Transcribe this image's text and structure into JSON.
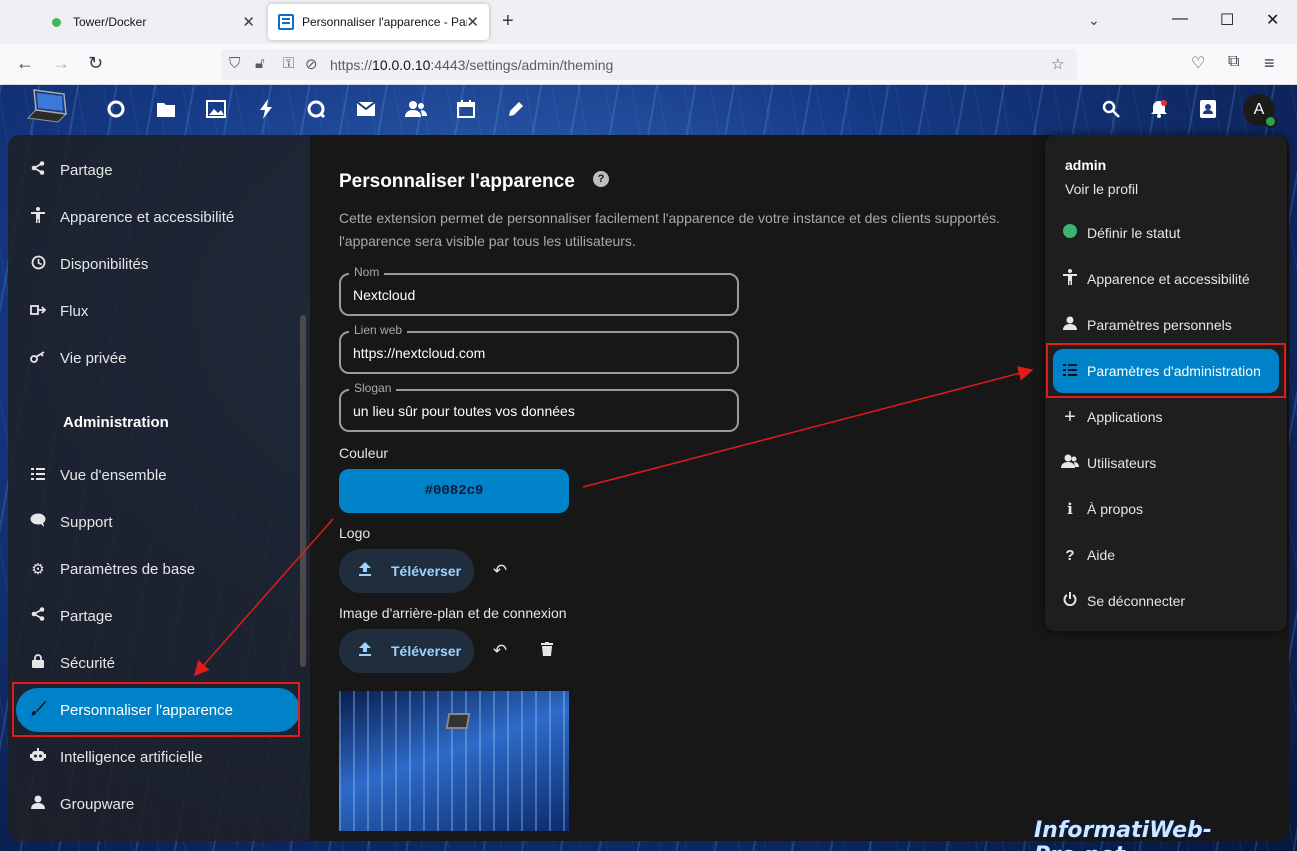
{
  "browser": {
    "tabs": [
      {
        "title": "Tower/Docker"
      },
      {
        "title": "Personnaliser l'apparence - Paramètres"
      }
    ],
    "url_prefix": "https://",
    "url_host": "10.0.0.10",
    "url_rest": ":4443/settings/admin/theming"
  },
  "header": {
    "avatar_letter": "A",
    "apps": [
      "dashboard-icon",
      "files-icon",
      "photos-icon",
      "activity-icon",
      "talk-icon",
      "mail-icon",
      "contacts-icon",
      "calendar-icon",
      "notes-icon"
    ]
  },
  "sidebar": {
    "personal_items": [
      {
        "label": "Partage",
        "icon": "share-icon"
      },
      {
        "label": "Apparence et accessibilité",
        "icon": "accessibility-icon"
      },
      {
        "label": "Disponibilités",
        "icon": "clock-icon"
      },
      {
        "label": "Flux",
        "icon": "flow-icon"
      },
      {
        "label": "Vie privée",
        "icon": "key-icon"
      }
    ],
    "admin_heading": "Administration",
    "admin_items": [
      {
        "label": "Vue d'ensemble",
        "icon": "list-icon"
      },
      {
        "label": "Support",
        "icon": "chat-icon"
      },
      {
        "label": "Paramètres de base",
        "icon": "gear-icon"
      },
      {
        "label": "Partage",
        "icon": "share-icon"
      },
      {
        "label": "Sécurité",
        "icon": "lock-icon"
      },
      {
        "label": "Personnaliser l'apparence",
        "icon": "paintbrush-icon",
        "active": true
      },
      {
        "label": "Intelligence artificielle",
        "icon": "robot-icon"
      },
      {
        "label": "Groupware",
        "icon": "group-icon"
      }
    ]
  },
  "main": {
    "title": "Personnaliser l'apparence",
    "description_line1": "Cette extension permet de personnaliser facilement l'apparence de votre instance et des clients supportés.",
    "description_line2": "l'apparence sera visible par tous les utilisateurs.",
    "name_label": "Nom",
    "name_value": "Nextcloud",
    "weblink_label": "Lien web",
    "weblink_value": "https://nextcloud.com",
    "slogan_label": "Slogan",
    "slogan_value": "un lieu sûr pour toutes vos données",
    "color_label": "Couleur",
    "color_value": "#0082c9",
    "logo_label": "Logo",
    "upload_label": "Téléverser",
    "background_label": "Image d'arrière-plan et de connexion"
  },
  "user_menu": {
    "username": "admin",
    "view_profile": "Voir le profil",
    "items": [
      {
        "label": "Définir le statut",
        "icon": "status-dot-icon"
      },
      {
        "label": "Apparence et accessibilité",
        "icon": "accessibility-icon"
      },
      {
        "label": "Paramètres personnels",
        "icon": "person-icon"
      },
      {
        "label": "Paramètres d'administration",
        "icon": "admin-list-icon",
        "active": true
      },
      {
        "label": "Applications",
        "icon": "plus-icon"
      },
      {
        "label": "Utilisateurs",
        "icon": "users-icon"
      },
      {
        "label": "À propos",
        "icon": "info-icon"
      },
      {
        "label": "Aide",
        "icon": "help-icon"
      },
      {
        "label": "Se déconnecter",
        "icon": "power-icon"
      }
    ]
  },
  "colors": {
    "accent": "#0082c9",
    "annotation": "#e01b1b"
  },
  "watermark": "InformatiWeb-Pro.net"
}
